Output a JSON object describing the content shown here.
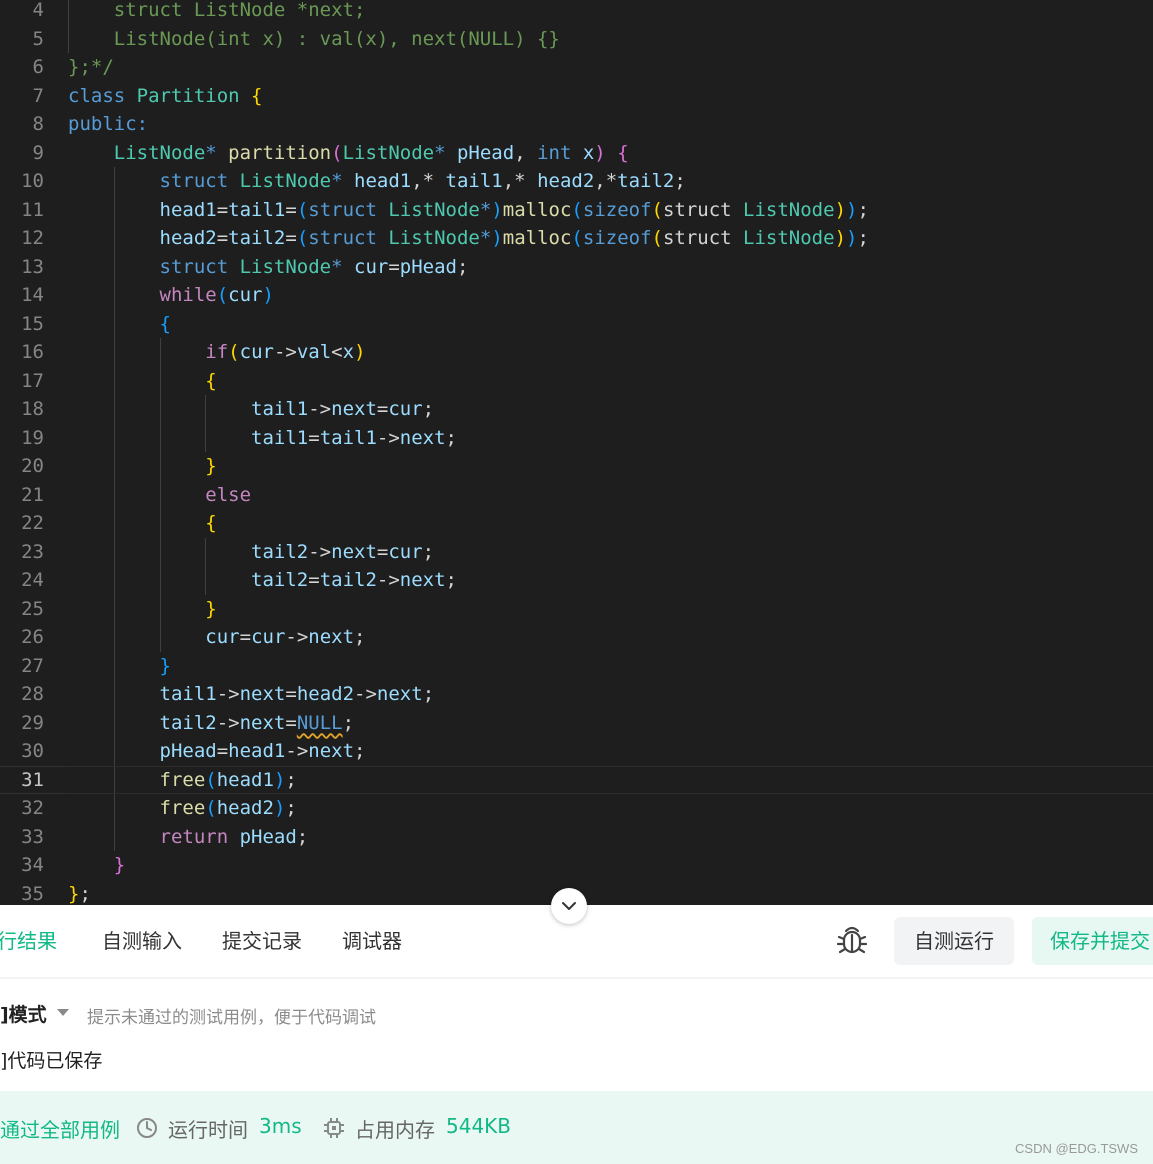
{
  "editor": {
    "current_line": 31,
    "lines": [
      {
        "n": "4",
        "tokens": [
          [
            "    struct ListNode *next;",
            "cm"
          ]
        ]
      },
      {
        "n": "5",
        "tokens": [
          [
            "    ListNode(int x) : val(x), next(NULL) {}",
            "cm"
          ]
        ]
      },
      {
        "n": "6",
        "tokens": [
          [
            "};*/",
            "cm"
          ]
        ]
      },
      {
        "n": "7",
        "tokens": [
          [
            "class ",
            "kw"
          ],
          [
            "Partition ",
            "ty"
          ],
          [
            "{",
            "b1"
          ]
        ]
      },
      {
        "n": "8",
        "tokens": [
          [
            "public:",
            "kw"
          ]
        ]
      },
      {
        "n": "9",
        "tokens": [
          [
            "    ",
            "df"
          ],
          [
            "ListNode",
            "ty"
          ],
          [
            "* ",
            "kw"
          ],
          [
            "partition",
            "fn"
          ],
          [
            "(",
            "b2"
          ],
          [
            "ListNode",
            "ty"
          ],
          [
            "* ",
            "kw"
          ],
          [
            "pHead",
            "id"
          ],
          [
            ", ",
            "df"
          ],
          [
            "int ",
            "kw"
          ],
          [
            "x",
            "id"
          ],
          [
            ") ",
            "b2"
          ],
          [
            "{",
            "b2"
          ]
        ]
      },
      {
        "n": "10",
        "tokens": [
          [
            "        ",
            "df"
          ],
          [
            "struct ",
            "kw"
          ],
          [
            "ListNode",
            "ty"
          ],
          [
            "* ",
            "kw"
          ],
          [
            "head1",
            "id"
          ],
          [
            ",* ",
            "df"
          ],
          [
            "tail1",
            "id"
          ],
          [
            ",* ",
            "df"
          ],
          [
            "head2",
            "id"
          ],
          [
            ",*",
            "df"
          ],
          [
            "tail2",
            "id"
          ],
          [
            ";",
            "df"
          ]
        ]
      },
      {
        "n": "11",
        "tokens": [
          [
            "        ",
            "df"
          ],
          [
            "head1",
            "id"
          ],
          [
            "=",
            "df"
          ],
          [
            "tail1",
            "id"
          ],
          [
            "=",
            "df"
          ],
          [
            "(",
            "b3"
          ],
          [
            "struct ",
            "kw"
          ],
          [
            "ListNode",
            "ty"
          ],
          [
            "*",
            "kw"
          ],
          [
            ")",
            "b3"
          ],
          [
            "malloc",
            "fn"
          ],
          [
            "(",
            "b3"
          ],
          [
            "sizeof",
            "kw"
          ],
          [
            "(",
            "b1"
          ],
          [
            "struct ",
            "df"
          ],
          [
            "ListNode",
            "ty"
          ],
          [
            ")",
            "b1"
          ],
          [
            ")",
            "b3"
          ],
          [
            ";",
            "df"
          ]
        ]
      },
      {
        "n": "12",
        "tokens": [
          [
            "        ",
            "df"
          ],
          [
            "head2",
            "id"
          ],
          [
            "=",
            "df"
          ],
          [
            "tail2",
            "id"
          ],
          [
            "=",
            "df"
          ],
          [
            "(",
            "b3"
          ],
          [
            "struct ",
            "kw"
          ],
          [
            "ListNode",
            "ty"
          ],
          [
            "*",
            "kw"
          ],
          [
            ")",
            "b3"
          ],
          [
            "malloc",
            "fn"
          ],
          [
            "(",
            "b3"
          ],
          [
            "sizeof",
            "kw"
          ],
          [
            "(",
            "b1"
          ],
          [
            "struct ",
            "df"
          ],
          [
            "ListNode",
            "ty"
          ],
          [
            ")",
            "b1"
          ],
          [
            ")",
            "b3"
          ],
          [
            ";",
            "df"
          ]
        ]
      },
      {
        "n": "13",
        "tokens": [
          [
            "        ",
            "df"
          ],
          [
            "struct ",
            "kw"
          ],
          [
            "ListNode",
            "ty"
          ],
          [
            "* ",
            "kw"
          ],
          [
            "cur",
            "id"
          ],
          [
            "=",
            "df"
          ],
          [
            "pHead",
            "id"
          ],
          [
            ";",
            "df"
          ]
        ]
      },
      {
        "n": "14",
        "tokens": [
          [
            "        ",
            "df"
          ],
          [
            "while",
            "kw2"
          ],
          [
            "(",
            "b3"
          ],
          [
            "cur",
            "id"
          ],
          [
            ")",
            "b3"
          ]
        ]
      },
      {
        "n": "15",
        "tokens": [
          [
            "        ",
            "df"
          ],
          [
            "{",
            "b3"
          ]
        ]
      },
      {
        "n": "16",
        "tokens": [
          [
            "            ",
            "df"
          ],
          [
            "if",
            "kw2"
          ],
          [
            "(",
            "b1"
          ],
          [
            "cur",
            "id"
          ],
          [
            "->",
            "df"
          ],
          [
            "val",
            "id"
          ],
          [
            "<",
            "df"
          ],
          [
            "x",
            "id"
          ],
          [
            ")",
            "b1"
          ]
        ]
      },
      {
        "n": "17",
        "tokens": [
          [
            "            ",
            "df"
          ],
          [
            "{",
            "b1"
          ]
        ]
      },
      {
        "n": "18",
        "tokens": [
          [
            "                ",
            "df"
          ],
          [
            "tail1",
            "id"
          ],
          [
            "->",
            "df"
          ],
          [
            "next",
            "id"
          ],
          [
            "=",
            "df"
          ],
          [
            "cur",
            "id"
          ],
          [
            ";",
            "df"
          ]
        ]
      },
      {
        "n": "19",
        "tokens": [
          [
            "                ",
            "df"
          ],
          [
            "tail1",
            "id"
          ],
          [
            "=",
            "df"
          ],
          [
            "tail1",
            "id"
          ],
          [
            "->",
            "df"
          ],
          [
            "next",
            "id"
          ],
          [
            ";",
            "df"
          ]
        ]
      },
      {
        "n": "20",
        "tokens": [
          [
            "            ",
            "df"
          ],
          [
            "}",
            "b1"
          ]
        ]
      },
      {
        "n": "21",
        "tokens": [
          [
            "            ",
            "df"
          ],
          [
            "else",
            "kw2"
          ]
        ]
      },
      {
        "n": "22",
        "tokens": [
          [
            "            ",
            "df"
          ],
          [
            "{",
            "b1"
          ]
        ]
      },
      {
        "n": "23",
        "tokens": [
          [
            "                ",
            "df"
          ],
          [
            "tail2",
            "id"
          ],
          [
            "->",
            "df"
          ],
          [
            "next",
            "id"
          ],
          [
            "=",
            "df"
          ],
          [
            "cur",
            "id"
          ],
          [
            ";",
            "df"
          ]
        ]
      },
      {
        "n": "24",
        "tokens": [
          [
            "                ",
            "df"
          ],
          [
            "tail2",
            "id"
          ],
          [
            "=",
            "df"
          ],
          [
            "tail2",
            "id"
          ],
          [
            "->",
            "df"
          ],
          [
            "next",
            "id"
          ],
          [
            ";",
            "df"
          ]
        ]
      },
      {
        "n": "25",
        "tokens": [
          [
            "            ",
            "df"
          ],
          [
            "}",
            "b1"
          ]
        ]
      },
      {
        "n": "26",
        "tokens": [
          [
            "            ",
            "df"
          ],
          [
            "cur",
            "id"
          ],
          [
            "=",
            "df"
          ],
          [
            "cur",
            "id"
          ],
          [
            "->",
            "df"
          ],
          [
            "next",
            "id"
          ],
          [
            ";",
            "df"
          ]
        ]
      },
      {
        "n": "27",
        "tokens": [
          [
            "        ",
            "df"
          ],
          [
            "}",
            "b3"
          ]
        ]
      },
      {
        "n": "28",
        "tokens": [
          [
            "        ",
            "df"
          ],
          [
            "tail1",
            "id"
          ],
          [
            "->",
            "df"
          ],
          [
            "next",
            "id"
          ],
          [
            "=",
            "df"
          ],
          [
            "head2",
            "id"
          ],
          [
            "->",
            "df"
          ],
          [
            "next",
            "id"
          ],
          [
            ";",
            "df"
          ]
        ]
      },
      {
        "n": "29",
        "tokens": [
          [
            "        ",
            "df"
          ],
          [
            "tail2",
            "id"
          ],
          [
            "->",
            "df"
          ],
          [
            "next",
            "id"
          ],
          [
            "=",
            "df"
          ],
          [
            "NULL",
            "kw sq"
          ],
          [
            ";",
            "df"
          ]
        ]
      },
      {
        "n": "30",
        "tokens": [
          [
            "        ",
            "df"
          ],
          [
            "pHead",
            "id"
          ],
          [
            "=",
            "df"
          ],
          [
            "head1",
            "id"
          ],
          [
            "->",
            "df"
          ],
          [
            "next",
            "id"
          ],
          [
            ";",
            "df"
          ]
        ]
      },
      {
        "n": "31",
        "tokens": [
          [
            "        ",
            "df"
          ],
          [
            "free",
            "fn"
          ],
          [
            "(",
            "b3"
          ],
          [
            "head1",
            "id"
          ],
          [
            ")",
            "b3"
          ],
          [
            ";",
            "df"
          ]
        ]
      },
      {
        "n": "32",
        "tokens": [
          [
            "        ",
            "df"
          ],
          [
            "free",
            "fn"
          ],
          [
            "(",
            "b3"
          ],
          [
            "head2",
            "id"
          ],
          [
            ")",
            "b3"
          ],
          [
            ";",
            "df"
          ]
        ]
      },
      {
        "n": "33",
        "tokens": [
          [
            "        ",
            "df"
          ],
          [
            "return ",
            "kw2"
          ],
          [
            "pHead",
            "id"
          ],
          [
            ";",
            "df"
          ]
        ]
      },
      {
        "n": "34",
        "tokens": [
          [
            "    ",
            "df"
          ],
          [
            "}",
            "b2"
          ]
        ]
      },
      {
        "n": "35",
        "tokens": [
          [
            "}",
            "b1"
          ],
          [
            ";",
            "df"
          ]
        ]
      }
    ]
  },
  "tabs": {
    "result": "行结果",
    "custom_input": "自测输入",
    "submissions": "提交记录",
    "debugger": "调试器"
  },
  "actions": {
    "self_test": "自测运行",
    "save_submit": "保存并提交"
  },
  "mode": {
    "label": "]模式",
    "hint": "提示未通过的测试用例，便于代码调试"
  },
  "status": {
    "saved": "]代码已保存"
  },
  "result": {
    "pass": "通过全部用例",
    "time_label": "运行时间",
    "time_value": "3ms",
    "mem_label": "占用内存",
    "mem_value": "544KB"
  },
  "watermark": "CSDN @EDG.TSWS",
  "colors": {
    "accent": "#12b886",
    "editor_bg": "#1e1e1e"
  },
  "icons": [
    "chevron-down-icon",
    "bug-icon",
    "clock-icon",
    "cpu-icon"
  ]
}
